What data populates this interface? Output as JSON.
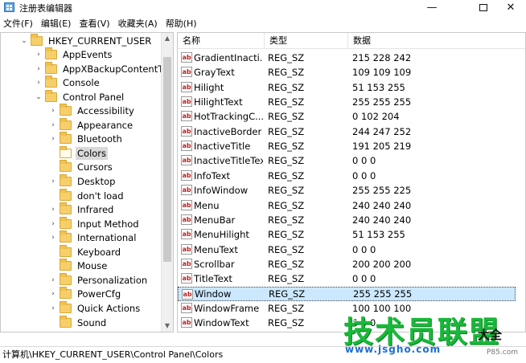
{
  "window": {
    "title": "注册表编辑器",
    "minimize": "—",
    "close": "✕"
  },
  "menu": [
    "文件(F)",
    "编辑(E)",
    "查看(V)",
    "收藏夹(A)",
    "帮助(H)"
  ],
  "tree": [
    {
      "label": "HKEY_CURRENT_USER",
      "arrow": "⌄",
      "selected": false
    },
    {
      "label": "AppEvents",
      "arrow": "›",
      "selected": false
    },
    {
      "label": "AppXBackupContentType",
      "arrow": "›",
      "selected": false
    },
    {
      "label": "Console",
      "arrow": "›",
      "selected": false
    },
    {
      "label": "Control Panel",
      "arrow": "⌄",
      "selected": false
    },
    {
      "label": "Accessibility",
      "arrow": "›",
      "selected": false
    },
    {
      "label": "Appearance",
      "arrow": "›",
      "selected": false
    },
    {
      "label": "Bluetooth",
      "arrow": "›",
      "selected": false
    },
    {
      "label": "Colors",
      "arrow": "",
      "selected": true
    },
    {
      "label": "Cursors",
      "arrow": "",
      "selected": false
    },
    {
      "label": "Desktop",
      "arrow": "›",
      "selected": false
    },
    {
      "label": "don't load",
      "arrow": "",
      "selected": false
    },
    {
      "label": "Infrared",
      "arrow": "›",
      "selected": false
    },
    {
      "label": "Input Method",
      "arrow": "›",
      "selected": false
    },
    {
      "label": "International",
      "arrow": "›",
      "selected": false
    },
    {
      "label": "Keyboard",
      "arrow": "",
      "selected": false
    },
    {
      "label": "Mouse",
      "arrow": "",
      "selected": false
    },
    {
      "label": "Personalization",
      "arrow": "›",
      "selected": false
    },
    {
      "label": "PowerCfg",
      "arrow": "›",
      "selected": false
    },
    {
      "label": "Quick Actions",
      "arrow": "›",
      "selected": false
    },
    {
      "label": "Sound",
      "arrow": "",
      "selected": false
    }
  ],
  "table": {
    "headers": [
      "名称",
      "类型",
      "数据"
    ],
    "rows": [
      {
        "name": "GradientInacti...",
        "type": "REG_SZ",
        "data": "215 228 242",
        "selected": false
      },
      {
        "name": "GrayText",
        "type": "REG_SZ",
        "data": "109 109 109",
        "selected": false
      },
      {
        "name": "Hilight",
        "type": "REG_SZ",
        "data": "51 153 255",
        "selected": false
      },
      {
        "name": "HilightText",
        "type": "REG_SZ",
        "data": "255 255 255",
        "selected": false
      },
      {
        "name": "HotTrackingC...",
        "type": "REG_SZ",
        "data": "0 102 204",
        "selected": false
      },
      {
        "name": "InactiveBorder",
        "type": "REG_SZ",
        "data": "244 247 252",
        "selected": false
      },
      {
        "name": "InactiveTitle",
        "type": "REG_SZ",
        "data": "191 205 219",
        "selected": false
      },
      {
        "name": "InactiveTitleText",
        "type": "REG_SZ",
        "data": "0 0 0",
        "selected": false
      },
      {
        "name": "InfoText",
        "type": "REG_SZ",
        "data": "0 0 0",
        "selected": false
      },
      {
        "name": "InfoWindow",
        "type": "REG_SZ",
        "data": "255 255 225",
        "selected": false
      },
      {
        "name": "Menu",
        "type": "REG_SZ",
        "data": "240 240 240",
        "selected": false
      },
      {
        "name": "MenuBar",
        "type": "REG_SZ",
        "data": "240 240 240",
        "selected": false
      },
      {
        "name": "MenuHilight",
        "type": "REG_SZ",
        "data": "51 153 255",
        "selected": false
      },
      {
        "name": "MenuText",
        "type": "REG_SZ",
        "data": "0 0 0",
        "selected": false
      },
      {
        "name": "Scrollbar",
        "type": "REG_SZ",
        "data": "200 200 200",
        "selected": false
      },
      {
        "name": "TitleText",
        "type": "REG_SZ",
        "data": "0 0 0",
        "selected": false
      },
      {
        "name": "Window",
        "type": "REG_SZ",
        "data": "255 255 255",
        "selected": true
      },
      {
        "name": "WindowFrame",
        "type": "REG_SZ",
        "data": "100 100 100",
        "selected": false
      },
      {
        "name": "WindowText",
        "type": "REG_SZ",
        "data": "0 0 0",
        "selected": false
      }
    ]
  },
  "status": "计算机\\HKEY_CURRENT_USER\\Control Panel\\Colors",
  "watermark": {
    "main": "技术员联盟",
    "url": "www.jsgho.com",
    "side": "大全",
    "small": "P85.com"
  },
  "colors": {
    "selected_row": "#cce8ff",
    "folder": "#f6cf6b",
    "watermark_green": "#19b83a"
  }
}
